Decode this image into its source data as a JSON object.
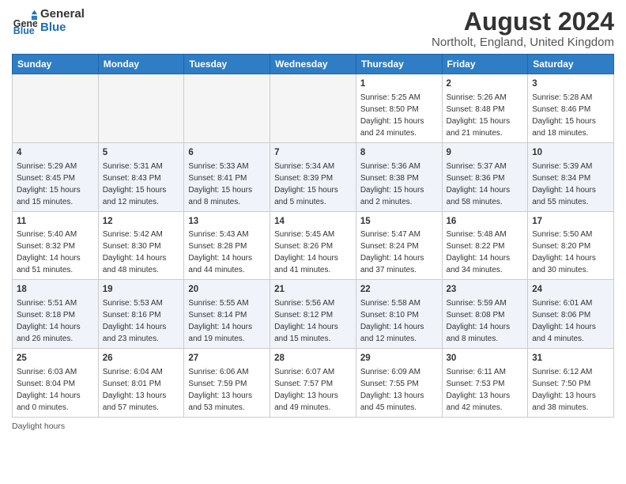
{
  "logo": {
    "line1": "General",
    "line2": "Blue"
  },
  "title": "August 2024",
  "location": "Northolt, England, United Kingdom",
  "days_of_week": [
    "Sunday",
    "Monday",
    "Tuesday",
    "Wednesday",
    "Thursday",
    "Friday",
    "Saturday"
  ],
  "footer": "Daylight hours",
  "weeks": [
    [
      {
        "day": "",
        "info": ""
      },
      {
        "day": "",
        "info": ""
      },
      {
        "day": "",
        "info": ""
      },
      {
        "day": "",
        "info": ""
      },
      {
        "day": "1",
        "info": "Sunrise: 5:25 AM\nSunset: 8:50 PM\nDaylight: 15 hours\nand 24 minutes."
      },
      {
        "day": "2",
        "info": "Sunrise: 5:26 AM\nSunset: 8:48 PM\nDaylight: 15 hours\nand 21 minutes."
      },
      {
        "day": "3",
        "info": "Sunrise: 5:28 AM\nSunset: 8:46 PM\nDaylight: 15 hours\nand 18 minutes."
      }
    ],
    [
      {
        "day": "4",
        "info": "Sunrise: 5:29 AM\nSunset: 8:45 PM\nDaylight: 15 hours\nand 15 minutes."
      },
      {
        "day": "5",
        "info": "Sunrise: 5:31 AM\nSunset: 8:43 PM\nDaylight: 15 hours\nand 12 minutes."
      },
      {
        "day": "6",
        "info": "Sunrise: 5:33 AM\nSunset: 8:41 PM\nDaylight: 15 hours\nand 8 minutes."
      },
      {
        "day": "7",
        "info": "Sunrise: 5:34 AM\nSunset: 8:39 PM\nDaylight: 15 hours\nand 5 minutes."
      },
      {
        "day": "8",
        "info": "Sunrise: 5:36 AM\nSunset: 8:38 PM\nDaylight: 15 hours\nand 2 minutes."
      },
      {
        "day": "9",
        "info": "Sunrise: 5:37 AM\nSunset: 8:36 PM\nDaylight: 14 hours\nand 58 minutes."
      },
      {
        "day": "10",
        "info": "Sunrise: 5:39 AM\nSunset: 8:34 PM\nDaylight: 14 hours\nand 55 minutes."
      }
    ],
    [
      {
        "day": "11",
        "info": "Sunrise: 5:40 AM\nSunset: 8:32 PM\nDaylight: 14 hours\nand 51 minutes."
      },
      {
        "day": "12",
        "info": "Sunrise: 5:42 AM\nSunset: 8:30 PM\nDaylight: 14 hours\nand 48 minutes."
      },
      {
        "day": "13",
        "info": "Sunrise: 5:43 AM\nSunset: 8:28 PM\nDaylight: 14 hours\nand 44 minutes."
      },
      {
        "day": "14",
        "info": "Sunrise: 5:45 AM\nSunset: 8:26 PM\nDaylight: 14 hours\nand 41 minutes."
      },
      {
        "day": "15",
        "info": "Sunrise: 5:47 AM\nSunset: 8:24 PM\nDaylight: 14 hours\nand 37 minutes."
      },
      {
        "day": "16",
        "info": "Sunrise: 5:48 AM\nSunset: 8:22 PM\nDaylight: 14 hours\nand 34 minutes."
      },
      {
        "day": "17",
        "info": "Sunrise: 5:50 AM\nSunset: 8:20 PM\nDaylight: 14 hours\nand 30 minutes."
      }
    ],
    [
      {
        "day": "18",
        "info": "Sunrise: 5:51 AM\nSunset: 8:18 PM\nDaylight: 14 hours\nand 26 minutes."
      },
      {
        "day": "19",
        "info": "Sunrise: 5:53 AM\nSunset: 8:16 PM\nDaylight: 14 hours\nand 23 minutes."
      },
      {
        "day": "20",
        "info": "Sunrise: 5:55 AM\nSunset: 8:14 PM\nDaylight: 14 hours\nand 19 minutes."
      },
      {
        "day": "21",
        "info": "Sunrise: 5:56 AM\nSunset: 8:12 PM\nDaylight: 14 hours\nand 15 minutes."
      },
      {
        "day": "22",
        "info": "Sunrise: 5:58 AM\nSunset: 8:10 PM\nDaylight: 14 hours\nand 12 minutes."
      },
      {
        "day": "23",
        "info": "Sunrise: 5:59 AM\nSunset: 8:08 PM\nDaylight: 14 hours\nand 8 minutes."
      },
      {
        "day": "24",
        "info": "Sunrise: 6:01 AM\nSunset: 8:06 PM\nDaylight: 14 hours\nand 4 minutes."
      }
    ],
    [
      {
        "day": "25",
        "info": "Sunrise: 6:03 AM\nSunset: 8:04 PM\nDaylight: 14 hours\nand 0 minutes."
      },
      {
        "day": "26",
        "info": "Sunrise: 6:04 AM\nSunset: 8:01 PM\nDaylight: 13 hours\nand 57 minutes."
      },
      {
        "day": "27",
        "info": "Sunrise: 6:06 AM\nSunset: 7:59 PM\nDaylight: 13 hours\nand 53 minutes."
      },
      {
        "day": "28",
        "info": "Sunrise: 6:07 AM\nSunset: 7:57 PM\nDaylight: 13 hours\nand 49 minutes."
      },
      {
        "day": "29",
        "info": "Sunrise: 6:09 AM\nSunset: 7:55 PM\nDaylight: 13 hours\nand 45 minutes."
      },
      {
        "day": "30",
        "info": "Sunrise: 6:11 AM\nSunset: 7:53 PM\nDaylight: 13 hours\nand 42 minutes."
      },
      {
        "day": "31",
        "info": "Sunrise: 6:12 AM\nSunset: 7:50 PM\nDaylight: 13 hours\nand 38 minutes."
      }
    ]
  ]
}
